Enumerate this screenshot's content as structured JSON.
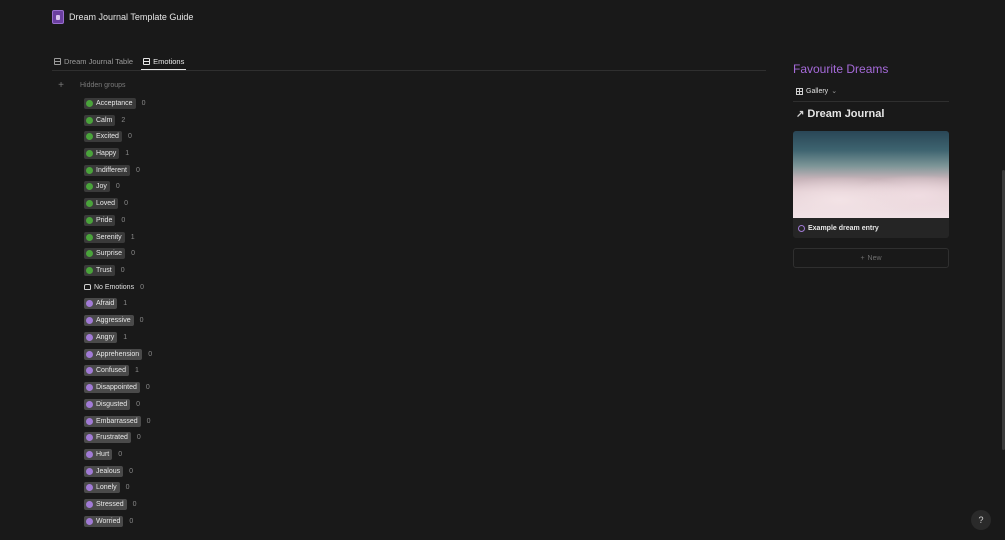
{
  "header": {
    "title": "Dream Journal Template Guide",
    "icon": "page-icon"
  },
  "tabs": [
    {
      "label": "Dream Journal Table",
      "icon": "table-icon",
      "active": false
    },
    {
      "label": "Emotions",
      "icon": "table-icon",
      "active": true
    }
  ],
  "board": {
    "hidden_groups_label": "Hidden groups",
    "groups": [
      {
        "label": "Acceptance",
        "count": "0",
        "color": "green"
      },
      {
        "label": "Calm",
        "count": "2",
        "color": "green"
      },
      {
        "label": "Excited",
        "count": "0",
        "color": "green"
      },
      {
        "label": "Happy",
        "count": "1",
        "color": "green"
      },
      {
        "label": "Indifferent",
        "count": "0",
        "color": "green"
      },
      {
        "label": "Joy",
        "count": "0",
        "color": "green"
      },
      {
        "label": "Loved",
        "count": "0",
        "color": "green"
      },
      {
        "label": "Pride",
        "count": "0",
        "color": "green"
      },
      {
        "label": "Serenity",
        "count": "1",
        "color": "green"
      },
      {
        "label": "Surprise",
        "count": "0",
        "color": "green"
      },
      {
        "label": "Trust",
        "count": "0",
        "color": "green"
      },
      {
        "label": "No Emotions",
        "count": "0",
        "color": "none"
      },
      {
        "label": "Afraid",
        "count": "1",
        "color": "purple"
      },
      {
        "label": "Aggressive",
        "count": "0",
        "color": "purple"
      },
      {
        "label": "Angry",
        "count": "1",
        "color": "purple"
      },
      {
        "label": "Apprehension",
        "count": "0",
        "color": "purple"
      },
      {
        "label": "Confused",
        "count": "1",
        "color": "purple"
      },
      {
        "label": "Disappointed",
        "count": "0",
        "color": "purple"
      },
      {
        "label": "Disgusted",
        "count": "0",
        "color": "purple"
      },
      {
        "label": "Embarrassed",
        "count": "0",
        "color": "purple"
      },
      {
        "label": "Frustrated",
        "count": "0",
        "color": "purple"
      },
      {
        "label": "Hurt",
        "count": "0",
        "color": "purple"
      },
      {
        "label": "Jealous",
        "count": "0",
        "color": "purple"
      },
      {
        "label": "Lonely",
        "count": "0",
        "color": "purple"
      },
      {
        "label": "Stressed",
        "count": "0",
        "color": "purple"
      },
      {
        "label": "Worried",
        "count": "0",
        "color": "purple"
      }
    ]
  },
  "favourites": {
    "title": "Favourite Dreams",
    "view_label": "Gallery",
    "linked_db_title": "Dream Journal",
    "card": {
      "label": "Example dream entry"
    },
    "new_label": "New"
  },
  "help_label": "?",
  "colors": {
    "accent_purple": "#a56ad9",
    "green_dot": "#4aa33b",
    "purple_dot": "#a17ad6",
    "background": "#191919"
  }
}
